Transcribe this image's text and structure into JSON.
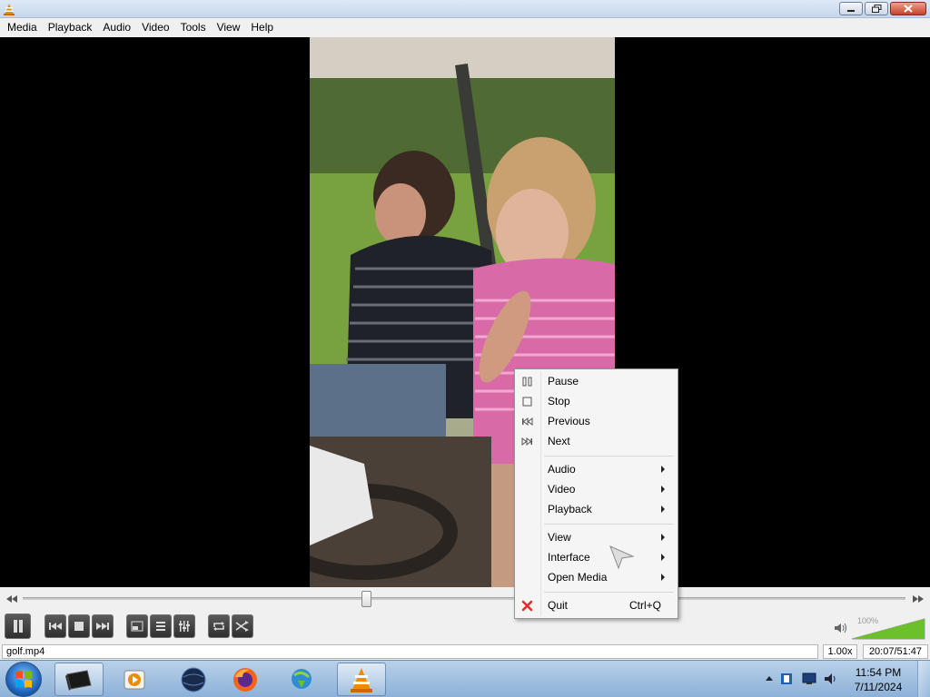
{
  "window": {
    "menu": [
      "Media",
      "Playback",
      "Audio",
      "Video",
      "Tools",
      "View",
      "Help"
    ]
  },
  "context_menu": {
    "items": [
      {
        "label": "Pause",
        "icon": "pause-icon"
      },
      {
        "label": "Stop",
        "icon": "stop-icon"
      },
      {
        "label": "Previous",
        "icon": "previous-icon"
      },
      {
        "label": "Next",
        "icon": "next-icon"
      },
      {
        "label": "Audio",
        "submenu": true
      },
      {
        "label": "Video",
        "submenu": true
      },
      {
        "label": "Playback",
        "submenu": true
      },
      {
        "label": "View",
        "submenu": true
      },
      {
        "label": "Interface",
        "submenu": true
      },
      {
        "label": "Open Media",
        "submenu": true
      },
      {
        "label": "Quit",
        "shortcut": "Ctrl+Q",
        "icon": "quit-icon"
      }
    ]
  },
  "player": {
    "seek_position": 0.389,
    "volume_label": "100%",
    "volume_level": 1.0
  },
  "status": {
    "filename": "golf.mp4",
    "speed": "1.00x",
    "time": "20:07/51:47"
  },
  "taskbar": {
    "clock_time": "11:54 PM",
    "clock_date": "7/11/2024"
  },
  "colors": {
    "accent_orange": "#f08a00",
    "quit_red": "#d9322a",
    "volume_green": "#6cc02a"
  }
}
